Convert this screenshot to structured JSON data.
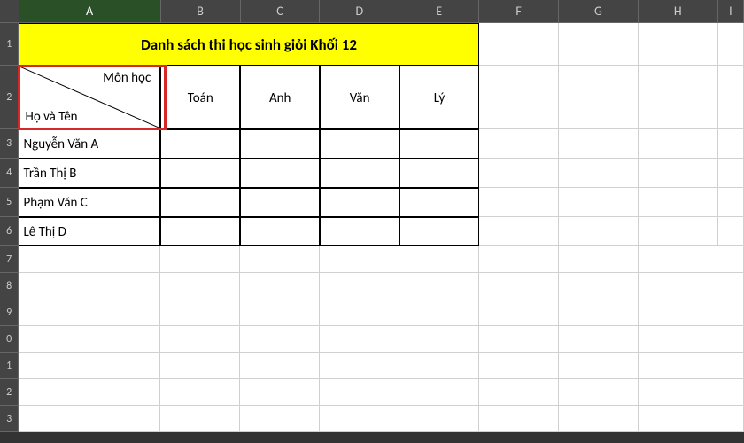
{
  "columns": [
    "A",
    "B",
    "C",
    "D",
    "E",
    "F",
    "G",
    "H",
    "I"
  ],
  "selected_column": "A",
  "row_numbers": [
    "1",
    "2",
    "3",
    "4",
    "5",
    "6",
    "7",
    "8",
    "9",
    "0",
    "1",
    "2",
    "3"
  ],
  "title": "Danh sách thi học sinh giỏi Khối 12",
  "diag_header": {
    "top": "Môn học",
    "bottom": "Họ và Tên"
  },
  "subjects": [
    "Toán",
    "Anh",
    "Văn",
    "Lý"
  ],
  "students": [
    "Nguyễn Văn A",
    "Trần Thị B",
    "Phạm Văn C",
    "Lê Thị D"
  ],
  "row_heights": {
    "r1": 48,
    "r2": 72,
    "data": 33,
    "empty": 30
  },
  "chart_data": {
    "type": "table",
    "title": "Danh sách thi học sinh giỏi Khối 12",
    "column_axis_label": "Môn học",
    "row_axis_label": "Họ và Tên",
    "columns": [
      "Toán",
      "Anh",
      "Văn",
      "Lý"
    ],
    "rows": [
      "Nguyễn Văn A",
      "Trần Thị B",
      "Phạm Văn C",
      "Lê Thị D"
    ],
    "values": [
      [
        null,
        null,
        null,
        null
      ],
      [
        null,
        null,
        null,
        null
      ],
      [
        null,
        null,
        null,
        null
      ],
      [
        null,
        null,
        null,
        null
      ]
    ]
  }
}
